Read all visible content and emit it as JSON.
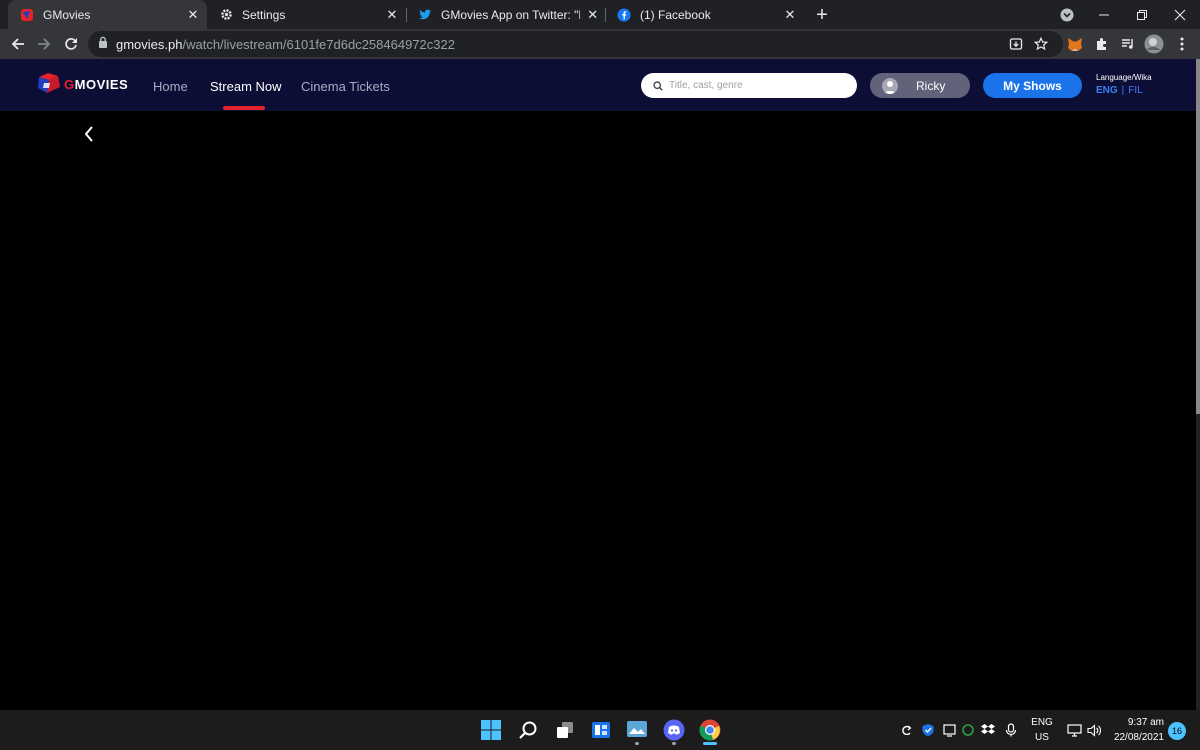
{
  "browser": {
    "tabs": [
      {
        "title": "GMovies",
        "icon": "gmovies-favicon",
        "active": true
      },
      {
        "title": "Settings",
        "icon": "gear-icon",
        "active": false
      },
      {
        "title": "GMovies App on Twitter: \"Red Co",
        "icon": "twitter-icon",
        "active": false
      },
      {
        "title": "(1) Facebook",
        "icon": "facebook-icon",
        "active": false
      }
    ],
    "new_tab_label": "+",
    "url": {
      "host": "gmovies.ph",
      "path": "/watch/livestream/6101fe7d6dc258464972c322"
    }
  },
  "site": {
    "logo_initial": "G",
    "logo_rest": "MOVIES",
    "nav": [
      "Home",
      "Stream Now",
      "Cinema Tickets"
    ],
    "active_nav": "Stream Now",
    "search": {
      "placeholder": "Title, cast, genre",
      "value": ""
    },
    "user": {
      "name": "Ricky"
    },
    "my_shows_label": "My Shows",
    "language": {
      "label": "Language/Wika",
      "options": [
        "ENG",
        "FIL"
      ],
      "selected": "ENG",
      "separator": "|"
    }
  },
  "taskbar": {
    "input_lang": "ENG",
    "input_region": "US",
    "time": "9:37 am",
    "date": "22/08/2021",
    "notification_count": "16"
  },
  "colors": {
    "site_header_bg": "#0d0e35",
    "accent_red": "#e52129",
    "accent_blue": "#1a73e8"
  }
}
